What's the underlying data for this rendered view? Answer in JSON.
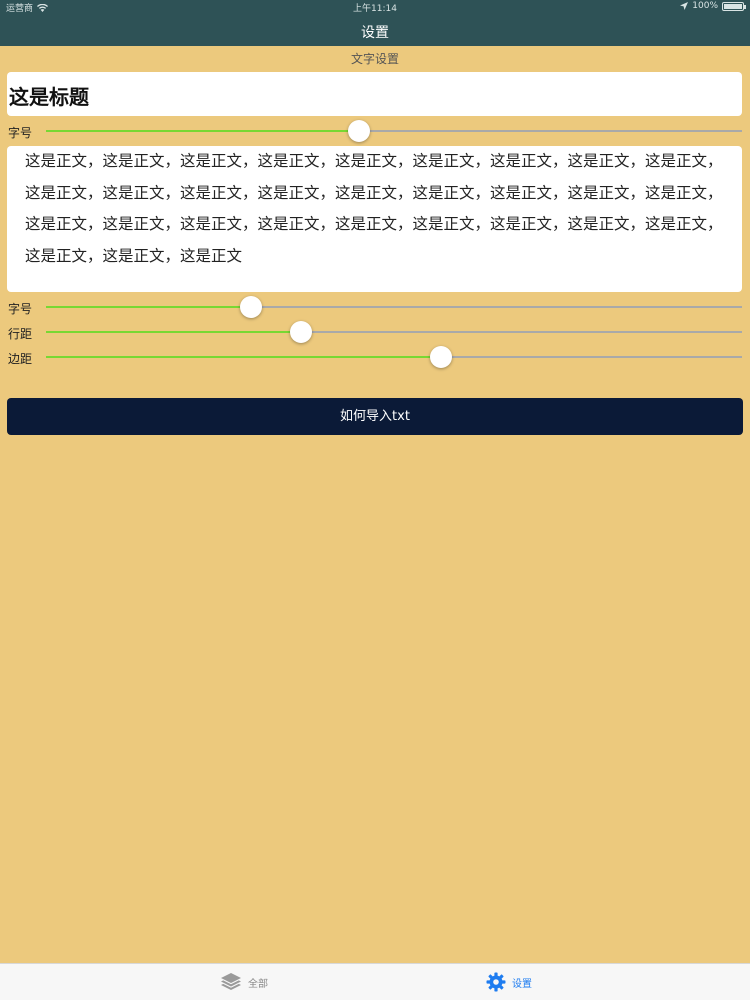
{
  "status_bar": {
    "carrier": "运营商",
    "time": "上午11:14",
    "battery": "100%",
    "battery_level": 1.0
  },
  "nav": {
    "title": "设置"
  },
  "section": {
    "title": "文字设置"
  },
  "title_preview": {
    "text": "这是标题"
  },
  "title_slider": {
    "label": "字号",
    "value": 0.45
  },
  "body_preview": {
    "text": "这是正文，这是正文，这是正文，这是正文，这是正文，这是正文，这是正文，这是正文，这是正文，这是正文，这是正文，这是正文，这是正文，这是正文，这是正文，这是正文，这是正文，这是正文，这是正文，这是正文，这是正文，这是正文，这是正文，这是正文，这是正文，这是正文，这是正文，这是正文，这是正文，这是正文"
  },
  "body_sliders": [
    {
      "label": "字号",
      "value": 0.295
    },
    {
      "label": "行距",
      "value": 0.367
    },
    {
      "label": "边距",
      "value": 0.568
    }
  ],
  "import_button": {
    "label": "如何导入txt"
  },
  "tabbar": {
    "tabs": [
      {
        "label": "全部",
        "icon": "layers-icon",
        "selected": false
      },
      {
        "label": "设置",
        "icon": "gear-icon",
        "selected": true
      }
    ]
  },
  "colors": {
    "background": "#ECC97D",
    "header": "#2E5256",
    "slider_fill": "#78D833",
    "button": "#0B1A37",
    "tab_active": "#1E7CF0"
  }
}
